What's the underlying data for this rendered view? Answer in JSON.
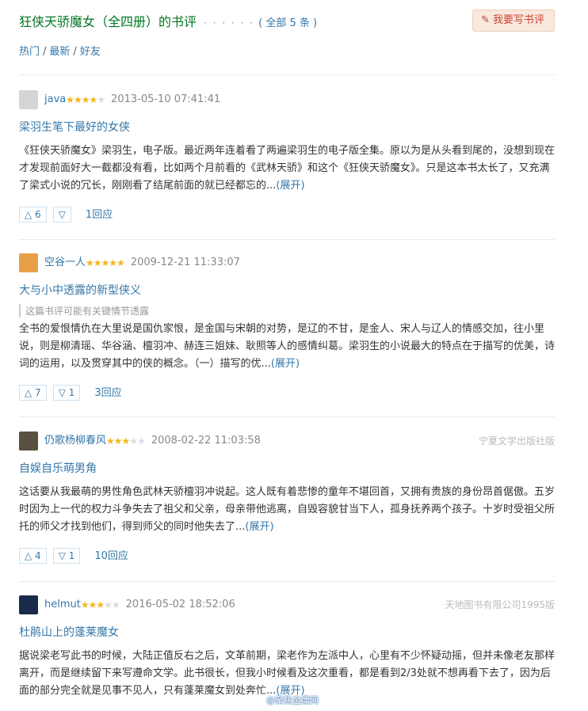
{
  "header": {
    "title": "狂侠天骄魔女（全四册）的书评",
    "dots": "· · · · · ·",
    "count": "( 全部 5 条 )",
    "write_label": "我要写书评"
  },
  "sort": {
    "hot": "热门",
    "newest": "最新",
    "friends": "好友"
  },
  "reviews": [
    {
      "author": "java",
      "stars": 4,
      "date": "2013-05-10 07:41:41",
      "publisher": "",
      "title": "梁羽生笔下最好的女侠",
      "spoiler": "",
      "body": "《狂侠天骄魔女》梁羽生，电子版。最近两年连着看了两遍梁羽生的电子版全集。原以为是从头看到尾的，没想到现在才发现前面好大一截都没有看，比如两个月前看的《武林天骄》和这个《狂侠天骄魔女》。只是这本书太长了，又充满了梁式小说的冗长，刚刚看了结尾前面的就已经都忘的...",
      "expand": "(展开)",
      "up": "△ 6",
      "down": "▽",
      "replies": "1回应",
      "avatar_color": "#d5d5d5"
    },
    {
      "author": "空谷一人",
      "stars": 5,
      "date": "2009-12-21 11:33:07",
      "publisher": "",
      "title": "大与小中透露的新型侠义",
      "spoiler": "这篇书评可能有关键情节透露",
      "body": "全书的爱恨情仇在大里说是国仇家恨，是金国与宋朝的对势，是辽的不甘，是金人、宋人与辽人的情感交加，往小里说，则是柳清瑶、华谷涵、檀羽冲、赫连三姐妹、耿照等人的感情纠葛。梁羽生的小说最大的特点在于描写的优美，诗词的运用，以及贯穿其中的侠的概念。（一）描写的优...",
      "expand": "(展开)",
      "up": "△ 7",
      "down": "▽ 1",
      "replies": "3回应",
      "avatar_color": "#e8a048"
    },
    {
      "author": "仍歌杨柳春风",
      "stars": 3,
      "date": "2008-02-22 11:03:58",
      "publisher": "宁夏文学出版社版",
      "title": "自娱自乐萌男角",
      "spoiler": "",
      "body": "这话要从我最萌的男性角色武林天骄檀羽冲说起。这人既有着悲惨的童年不堪回首，又拥有贵族的身份昂首倨傲。五岁时因为上一代的权力斗争失去了祖父和父亲，母亲带他逃离，自毁容貌甘当下人，孤身抚养两个孩子。十岁时受祖父所托的师父才找到他们，得到师父的同时他失去了...",
      "expand": "(展开)",
      "up": "△ 4",
      "down": "▽ 1",
      "replies": "10回应",
      "avatar_color": "#5a5040"
    },
    {
      "author": "helmut",
      "stars": 3,
      "date": "2016-05-02 18:52:06",
      "publisher": "天地图书有限公司1995版",
      "title": "杜鹃山上的蓬莱魔女",
      "spoiler": "",
      "body": "据说梁老写此书的时候，大陆正值反右之后，文革前期，梁老作为左派中人，心里有不少怀疑动摇，但并未像老友那样离开，而是继续留下来写遵命文学。此书很长，但我小时候看及这次重看，都是看到2/3处就不想再看下去了，因为后面的部分完全就是见事不见人，只有蓬莱魔女到处奔忙...",
      "expand": "(展开)",
      "up": "",
      "down": "",
      "replies": "",
      "avatar_color": "#1a2a4a"
    }
  ],
  "watermark": "@聚焦金庸网"
}
